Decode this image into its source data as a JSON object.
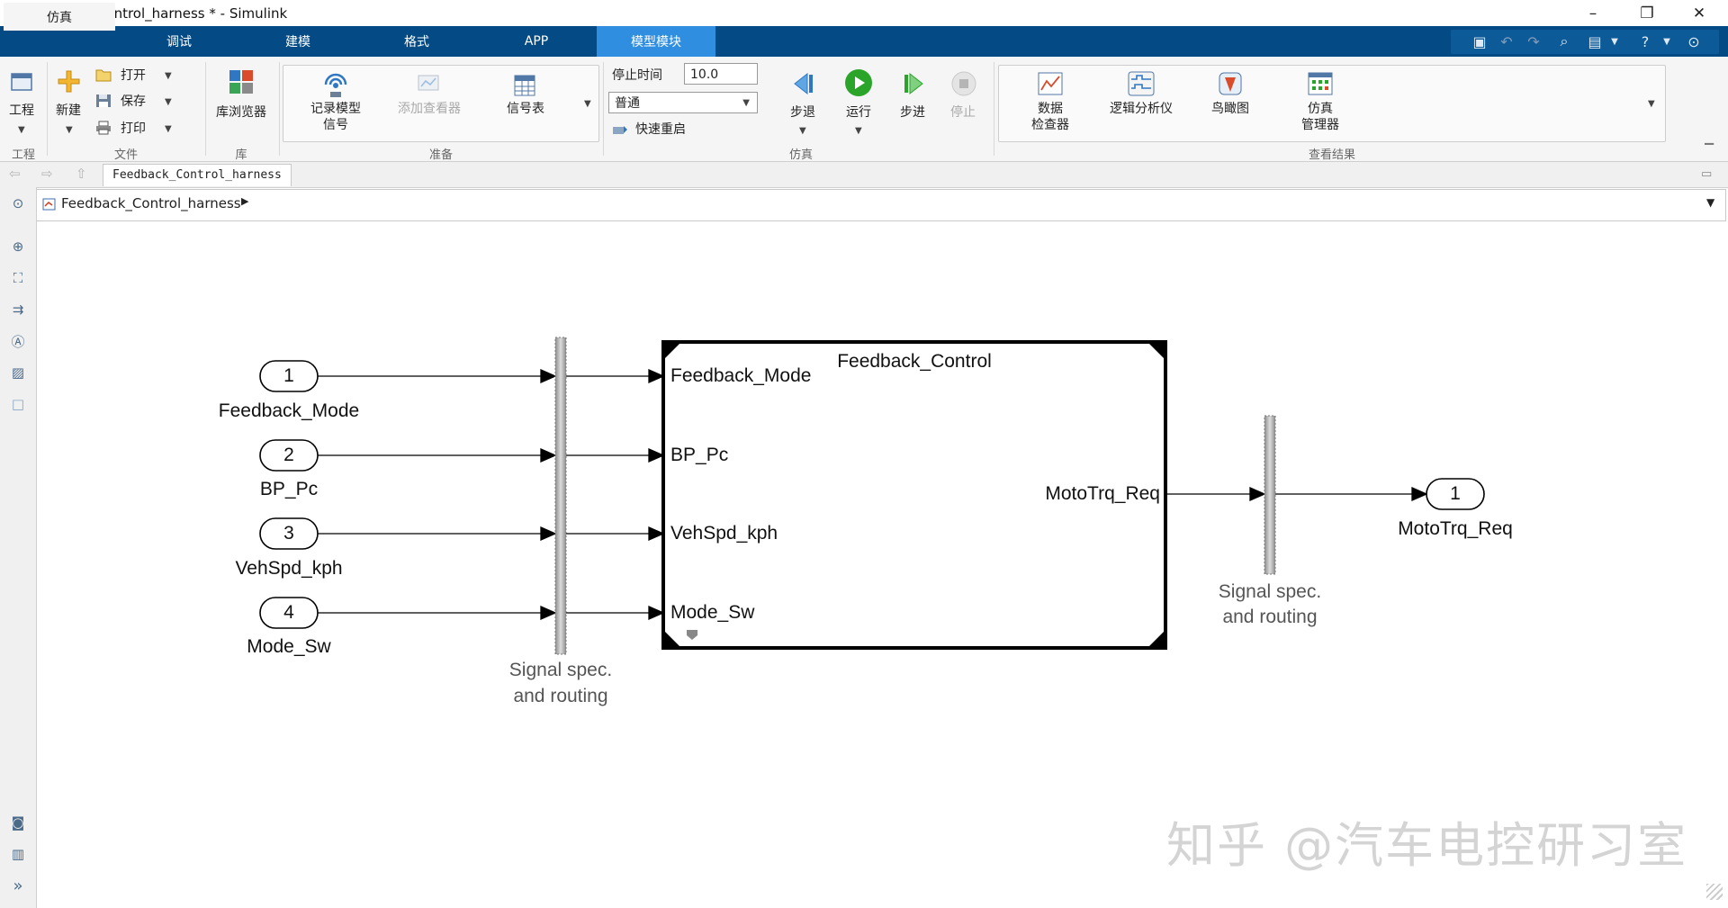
{
  "window": {
    "title": "Feedback_Control_harness * - Simulink",
    "controls": [
      "–",
      "❐",
      "✕"
    ]
  },
  "tabs": [
    "仿真",
    "调试",
    "建模",
    "格式",
    "APP",
    "模型模块"
  ],
  "active_tab": "仿真",
  "ribbon": {
    "project": {
      "label": "工程",
      "group": "工程"
    },
    "file": {
      "new": "新建",
      "open": "打开",
      "save": "保存",
      "print": "打印",
      "group": "文件"
    },
    "library": {
      "browser": "库浏览器",
      "group": "库"
    },
    "prepare": {
      "log_signals_line1": "记录模型",
      "log_signals_line2": "信号",
      "add_viewer": "添加查看器",
      "signal_table": "信号表",
      "group": "准备"
    },
    "simulate": {
      "stop_time_label": "停止时间",
      "stop_time_value": "10.0",
      "mode": "普通",
      "fast_restart": "快速重启",
      "step_back": "步退",
      "run": "运行",
      "step_forward": "步进",
      "stop": "停止",
      "group": "仿真"
    },
    "results": {
      "data_inspector_line1": "数据",
      "data_inspector_line2": "检查器",
      "logic_analyzer": "逻辑分析仪",
      "birds_eye": "鸟瞰图",
      "sim_manager_line1": "仿真",
      "sim_manager_line2": "管理器",
      "group": "查看结果"
    }
  },
  "nav": {
    "model_tab": "Feedback_Control_harness",
    "breadcrumb": "Feedback_Control_harness"
  },
  "diagram": {
    "inports": [
      {
        "num": "1",
        "name": "Feedback_Mode"
      },
      {
        "num": "2",
        "name": "BP_Pc"
      },
      {
        "num": "3",
        "name": "VehSpd_kph"
      },
      {
        "num": "4",
        "name": "Mode_Sw"
      }
    ],
    "routing_label_line1": "Signal spec.",
    "routing_label_line2": "and routing",
    "subsystem": {
      "name": "Feedback_Control",
      "inputs": [
        "Feedback_Mode",
        "BP_Pc",
        "VehSpd_kph",
        "Mode_Sw"
      ],
      "output": "MotoTrq_Req"
    },
    "outport": {
      "num": "1",
      "name": "MotoTrq_Req"
    }
  },
  "watermark": "知乎 @汽车电控研习室",
  "colors": {
    "tab_bar": "#044b85",
    "active_module_tab": "#2f8ee0",
    "ribbon_bg": "#f5f5f5",
    "run_green": "#2aa52a"
  }
}
